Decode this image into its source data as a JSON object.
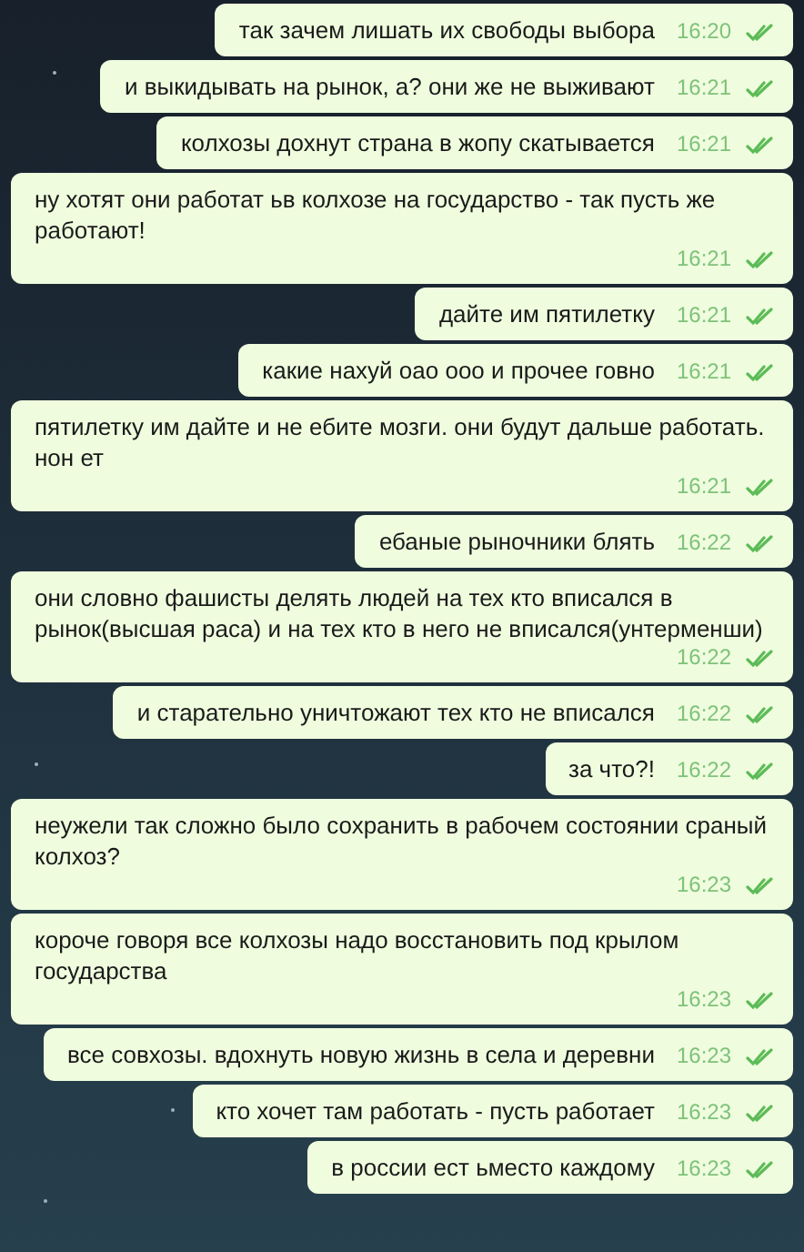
{
  "messages": [
    {
      "text": "так зачем лишать их свободы выбора",
      "time": "16:20",
      "read": true
    },
    {
      "text": "и выкидывать на рынок, а? они же не выживают",
      "time": "16:21",
      "read": true
    },
    {
      "text": "колхозы дохнут страна в жопу скатывается",
      "time": "16:21",
      "read": true
    },
    {
      "text": "ну хотят они работат ьв колхозе на государство - так пусть же работают!",
      "time": "16:21",
      "read": true
    },
    {
      "text": "дайте им пятилетку",
      "time": "16:21",
      "read": true
    },
    {
      "text": "какие нахуй оао ооо и прочее говно",
      "time": "16:21",
      "read": true
    },
    {
      "text": "пятилетку им дайте и не ебите мозги. они будут дальше работать. нон ет",
      "time": "16:21",
      "read": true
    },
    {
      "text": "ебаные рыночники блять",
      "time": "16:22",
      "read": true
    },
    {
      "text": "они словно фашисты делять людей на тех кто вписался в рынок(высшая раса) и на тех кто в него не вписался(унтерменши)",
      "time": "16:22",
      "read": true
    },
    {
      "text": "и старательно уничтожают тех кто не вписался",
      "time": "16:22",
      "read": true
    },
    {
      "text": "за что?!",
      "time": "16:22",
      "read": true
    },
    {
      "text": "неужели так сложно было сохранить в рабочем состоянии сраный колхоз?",
      "time": "16:23",
      "read": true
    },
    {
      "text": "короче говоря все колхозы надо восстановить под крылом государства",
      "time": "16:23",
      "read": true
    },
    {
      "text": "все совхозы. вдохнуть новую жизнь в села и деревни",
      "time": "16:23",
      "read": true
    },
    {
      "text": "кто хочет там работать - пусть работает",
      "time": "16:23",
      "read": true
    },
    {
      "text": "в россии ест ьместо каждому",
      "time": "16:23",
      "read": true
    }
  ]
}
